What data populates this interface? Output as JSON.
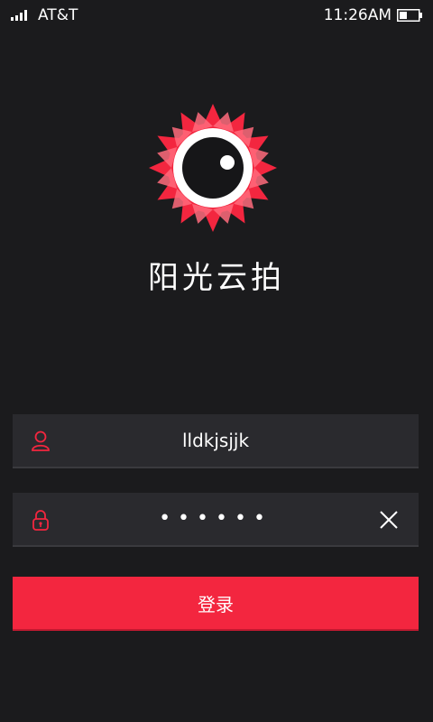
{
  "status_bar": {
    "carrier": "AT&T",
    "time": "11:26AM",
    "battery_level": 0.4,
    "signal_bars": 4
  },
  "app": {
    "name": "阳光云拍",
    "accent_color": "#f3263f"
  },
  "login": {
    "username_value": "lldkjsjjk",
    "password_mask": "••••••",
    "username_icon": "user-icon",
    "password_icon": "lock-icon",
    "clear_icon": "close-icon",
    "submit_label": "登录"
  }
}
